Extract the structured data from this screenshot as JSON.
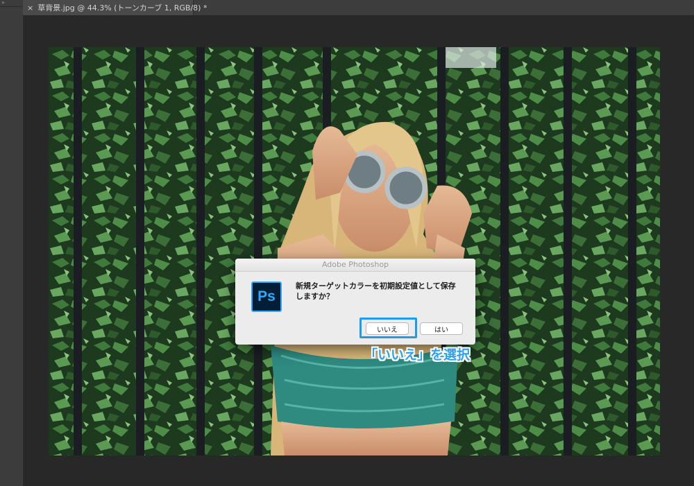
{
  "window": {
    "collapse_glyph": "»",
    "tab": {
      "close_glyph": "×",
      "title": "草背景.jpg @ 44.3% (トーンカーブ 1, RGB/8) *"
    }
  },
  "dialog": {
    "title": "Adobe Photoshop",
    "app_icon_text": "Ps",
    "message": "新規ターゲットカラーを初期設定値として保存しますか？",
    "buttons": {
      "no_label": "いいえ",
      "yes_label": "はい"
    }
  },
  "annotation": {
    "text": "「いいえ」を選択"
  },
  "colors": {
    "workspace": "#282828",
    "accent": "#1d9bf0",
    "ps_icon_bg": "#001e36",
    "ps_icon_fg": "#31a8ff"
  }
}
